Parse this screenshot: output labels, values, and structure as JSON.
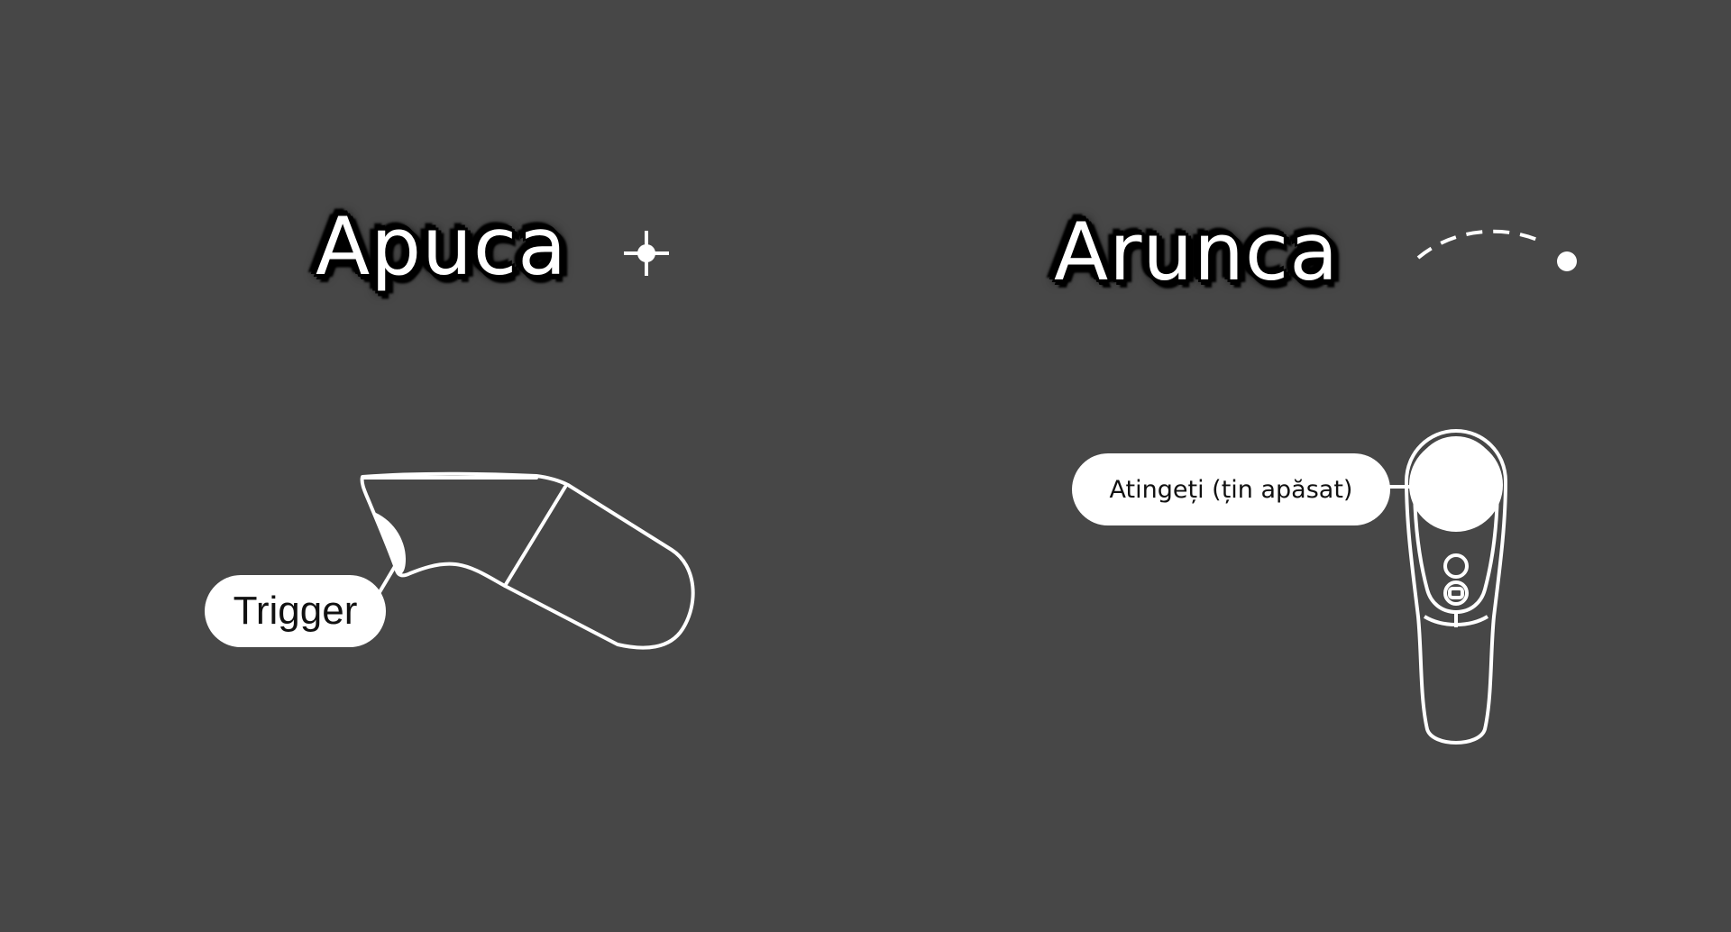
{
  "grab": {
    "title": "Apuca",
    "title_icon": "crosshair-icon",
    "controller": "remote-controller-side-view",
    "button_label": "Trigger"
  },
  "throw": {
    "title": "Arunca",
    "title_icon": "dashed-arc-trajectory-icon",
    "controller": "remote-controller-top-view",
    "button_label": "Atingeți (țin apăsat)"
  },
  "colors": {
    "background": "#474747",
    "foreground": "#ffffff",
    "label_text": "#111111",
    "title_outline": "#000000"
  }
}
